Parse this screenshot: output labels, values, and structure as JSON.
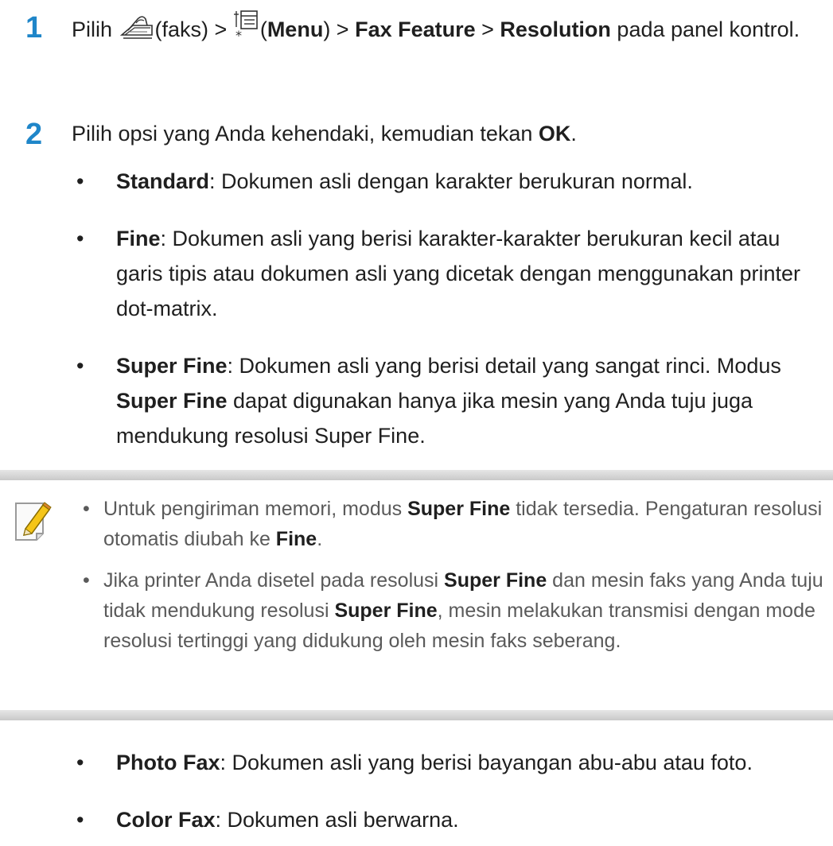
{
  "step1": {
    "number": "1",
    "pre": "Pilih ",
    "fax_word": "(faks) > ",
    "menu_word": "Menu",
    "sep1": ") > ",
    "fax_feature": "Fax Feature",
    "sep2": " > ",
    "resolution": "Resolution",
    "tail": " pada panel kontrol.",
    "fax_icon": "fax-icon",
    "menu_icon": "menu-icon"
  },
  "step2": {
    "number": "2",
    "text": "Pilih opsi yang Anda kehendaki, kemudian tekan ",
    "ok": "OK",
    "end": "."
  },
  "options": [
    {
      "label": "Standard",
      "text": ": Dokumen asli dengan karakter berukuran normal."
    },
    {
      "label": "Fine",
      "text": ": Dokumen asli yang berisi karakter-karakter berukuran kecil atau garis tipis atau dokumen asli yang dicetak dengan menggunakan printer dot-matrix."
    },
    {
      "label": "Super Fine",
      "text": ": Dokumen asli yang berisi detail yang sangat rinci. Modus ",
      "label2": "Super Fine",
      "text2": " dapat digunakan hanya jika mesin yang Anda tuju juga mendukung resolusi Super Fine."
    }
  ],
  "note": {
    "icon": "note-pencil-icon",
    "items": [
      {
        "a": "Untuk pengiriman memori, modus ",
        "b1": "Super Fine",
        "c": " tidak tersedia. Pengaturan resolusi otomatis diubah ke ",
        "b2": "Fine",
        "d": "."
      },
      {
        "a": "Jika printer Anda disetel pada resolusi ",
        "b1": "Super Fine",
        "c": " dan mesin faks yang Anda tuju tidak mendukung resolusi ",
        "b2": "Super Fine",
        "d": ", mesin melakukan transmisi dengan mode resolusi tertinggi yang didukung oleh mesin faks seberang."
      }
    ]
  },
  "options2": [
    {
      "label": "Photo Fax",
      "text": ": Dokumen asli yang berisi bayangan abu-abu atau foto."
    },
    {
      "label": "Color Fax",
      "text": ": Dokumen asli berwarna."
    }
  ],
  "colors": {
    "step_number": "#1f86c9",
    "note_text": "#5a5a5a",
    "note_bar": "#cfcfcf"
  }
}
